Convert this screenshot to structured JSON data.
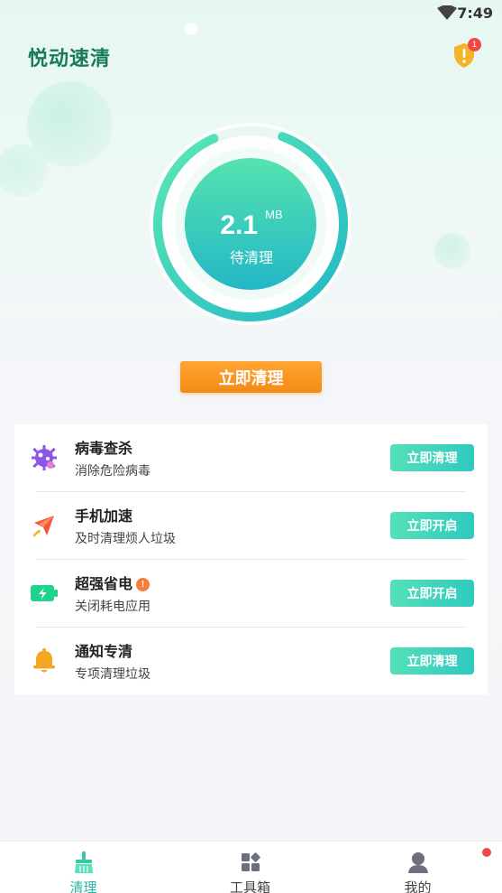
{
  "status_bar": {
    "time": "7:49",
    "wifi_icon": "wifi-icon"
  },
  "header": {
    "title": "悦动速清",
    "shield_icon": "shield-alert-icon",
    "badge_count": "1"
  },
  "gauge": {
    "amount": "2.1",
    "unit": "MB",
    "label": "待清理",
    "progress_percent": 88
  },
  "primary_button": {
    "label": "立即清理"
  },
  "features": [
    {
      "icon": "virus-icon",
      "title": "病毒查杀",
      "subtitle": "消除危险病毒",
      "action": "立即清理",
      "warning": ""
    },
    {
      "icon": "rocket-icon",
      "title": "手机加速",
      "subtitle": "及时清理烦人垃圾",
      "action": "立即开启",
      "warning": ""
    },
    {
      "icon": "battery-icon",
      "title": "超强省电",
      "subtitle": "关闭耗电应用",
      "action": "立即开启",
      "warning": "!"
    },
    {
      "icon": "bell-icon",
      "title": "通知专清",
      "subtitle": "专项清理垃圾",
      "action": "立即清理",
      "warning": ""
    }
  ],
  "tabs": [
    {
      "icon": "broom-icon",
      "label": "清理",
      "active": true
    },
    {
      "icon": "toolbox-icon",
      "label": "工具箱",
      "active": false
    },
    {
      "icon": "user-icon",
      "label": "我的",
      "active": false
    }
  ],
  "colors": {
    "brand": "#177a5c",
    "accent": "#2fc9c0",
    "orange": "#f58a13",
    "alert": "#f04848"
  }
}
